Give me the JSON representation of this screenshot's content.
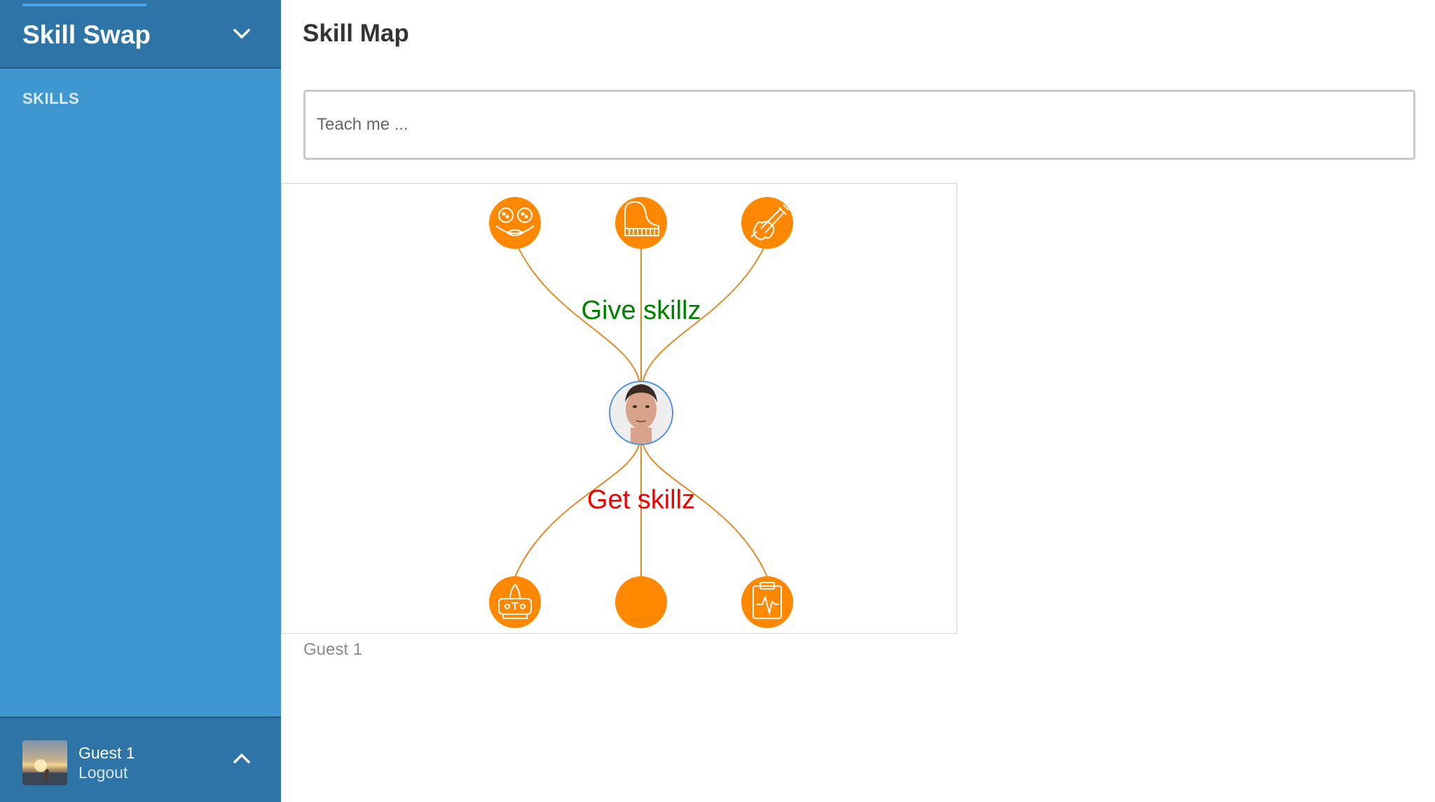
{
  "sidebar": {
    "app_title": "Skill Swap",
    "nav": {
      "skills_label": "SKILLS"
    },
    "footer": {
      "user_name": "Guest 1",
      "logout_label": "Logout"
    }
  },
  "main": {
    "page_title": "Skill Map",
    "search": {
      "placeholder": "Teach me ...",
      "value": ""
    },
    "skill_map": {
      "give_label": "Give skillz",
      "get_label": "Get skillz",
      "give_skills_icons": [
        "face-mask-icon",
        "piano-icon",
        "violin-icon"
      ],
      "get_skills_icons": [
        "rocket-launch-icon",
        "blank-skill-icon",
        "clipboard-heartbeat-icon"
      ]
    },
    "caption": "Guest 1"
  },
  "colors": {
    "sidebar_bg": "#3f97d0",
    "sidebar_header_bg": "#2e74a7",
    "node_orange": "#ff8800",
    "edge_orange": "#e08a2a",
    "give_label_color": "#008000",
    "get_label_color": "#ee0000"
  }
}
